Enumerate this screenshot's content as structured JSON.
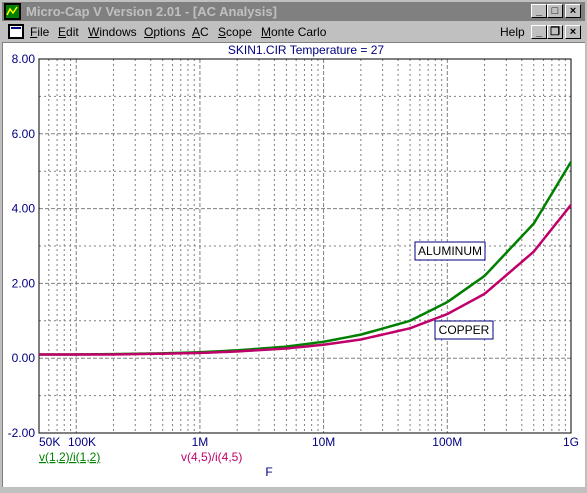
{
  "window": {
    "title": "Micro-Cap V Version 2.01 - [AC Analysis]",
    "buttons": {
      "minimize": "_",
      "maximize": "□",
      "close": "×"
    },
    "child_buttons": {
      "minimize": "_",
      "restore": "❐",
      "close": "×"
    }
  },
  "menu": {
    "items": [
      {
        "label": "File",
        "key": "F"
      },
      {
        "label": "Edit",
        "key": "E"
      },
      {
        "label": "Windows",
        "key": "W"
      },
      {
        "label": "Options",
        "key": "O"
      },
      {
        "label": "AC",
        "key": "A"
      },
      {
        "label": "Scope",
        "key": "S"
      },
      {
        "label": "Monte Carlo",
        "key": "M"
      }
    ],
    "help": "Help"
  },
  "chart_data": {
    "type": "line",
    "title": "SKIN1.CIR Temperature = 27",
    "xlabel": "F",
    "x_scale": "log",
    "xlim": [
      50000,
      1000000000
    ],
    "x_tick_labels": [
      "50K",
      "100K",
      "1M",
      "10M",
      "100M",
      "1G"
    ],
    "x_tick_values": [
      50000,
      100000,
      1000000,
      10000000,
      100000000,
      1000000000
    ],
    "ylim": [
      -2,
      8
    ],
    "y_tick_labels": [
      "-2.00",
      "0.00",
      "2.00",
      "4.00",
      "6.00",
      "8.00"
    ],
    "y_tick_values": [
      -2,
      0,
      2,
      4,
      6,
      8
    ],
    "grid": true,
    "colors": {
      "axis_text": "#000080",
      "grid": "#808080"
    },
    "series": [
      {
        "name": "v(1,2)/i(1,2)",
        "color": "#008000",
        "annotation": "ALUMINUM",
        "x": [
          50000,
          100000,
          200000,
          500000,
          1000000,
          2000000,
          5000000,
          10000000,
          20000000,
          50000000,
          100000000,
          200000000,
          500000000,
          1000000000
        ],
        "y": [
          0.1,
          0.1,
          0.11,
          0.13,
          0.16,
          0.21,
          0.31,
          0.44,
          0.63,
          1.0,
          1.5,
          2.2,
          3.6,
          5.25
        ]
      },
      {
        "name": "v(4,5)/i(4,5)",
        "color": "#c0006a",
        "annotation": "COPPER",
        "x": [
          50000,
          100000,
          200000,
          500000,
          1000000,
          2000000,
          5000000,
          10000000,
          20000000,
          50000000,
          100000000,
          200000000,
          500000000,
          1000000000
        ],
        "y": [
          0.1,
          0.1,
          0.1,
          0.12,
          0.14,
          0.18,
          0.26,
          0.36,
          0.5,
          0.8,
          1.18,
          1.72,
          2.85,
          4.1
        ]
      }
    ]
  }
}
